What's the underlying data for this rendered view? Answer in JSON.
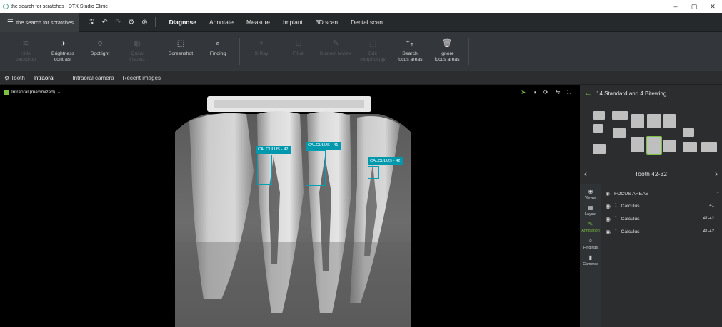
{
  "window": {
    "title": "the search for scratches - DTX Studio Clinic",
    "controls": [
      "–",
      "▢",
      "✕"
    ]
  },
  "menubar": {
    "app_menu_label": "the search for scratches",
    "tabs": [
      {
        "label": "Diagnose",
        "active": true
      },
      {
        "label": "Annotate",
        "active": false
      },
      {
        "label": "Measure",
        "active": false
      },
      {
        "label": "Implant",
        "active": false
      },
      {
        "label": "3D scan",
        "active": false
      },
      {
        "label": "Dental scan",
        "active": false
      }
    ]
  },
  "ribbon": {
    "tools": [
      {
        "label": "Hide\nbackdrop",
        "icon": "layers-icon",
        "disabled": true
      },
      {
        "label": "Brightness\ncontrast",
        "icon": "contrast-icon",
        "disabled": false
      },
      {
        "label": "Spotlight",
        "icon": "spotlight-icon",
        "disabled": false
      },
      {
        "label": "Quick\ninspect",
        "icon": "inspect-icon",
        "disabled": true
      },
      {
        "label": "Screenshot",
        "icon": "screenshot-icon",
        "disabled": false
      },
      {
        "label": "Finding",
        "icon": "finding-icon",
        "disabled": false
      },
      {
        "label": "X-Ray",
        "icon": "xray-icon",
        "disabled": true
      },
      {
        "label": "Fit all",
        "icon": "fit-icon",
        "disabled": true
      },
      {
        "label": "Custom review",
        "icon": "review-icon",
        "disabled": true
      },
      {
        "label": "Edit\nmorphology",
        "icon": "morphology-icon",
        "disabled": true
      },
      {
        "label": "Search\nfocus areas",
        "icon": "search-focus-icon",
        "disabled": false
      },
      {
        "label": "Ignore\nfocus areas",
        "icon": "ignore-focus-icon",
        "disabled": false
      }
    ]
  },
  "subtabs": {
    "items": [
      {
        "label": "Tooth",
        "active": false
      },
      {
        "label": "Intraoral",
        "active": true
      },
      {
        "label": "Intraoral camera",
        "active": false
      },
      {
        "label": "Recent images",
        "active": false
      }
    ],
    "more": "···"
  },
  "viewer": {
    "label": "Intraoral (maximized)",
    "annotations": [
      {
        "label": "CALCULUS - 42"
      },
      {
        "label": "CALCULUS - 41"
      },
      {
        "label": "CALCULUS - 42"
      }
    ]
  },
  "right_panel": {
    "header": "14 Standard and 4 Bitewing",
    "tooth_nav": "Tooth 42-32",
    "side_tools": [
      {
        "label": "Viewer",
        "icon": "eye-icon",
        "active": false
      },
      {
        "label": "Layout",
        "icon": "layout-icon",
        "active": false
      },
      {
        "label": "Annotation",
        "icon": "pencil-icon",
        "active": true
      },
      {
        "label": "Findings",
        "icon": "findings-icon",
        "active": false
      },
      {
        "label": "Cameras",
        "icon": "camera-icon",
        "active": false
      }
    ],
    "focus_areas": {
      "title": "FOCUS AREAS",
      "items": [
        {
          "name": "Calculus",
          "tooth": "41"
        },
        {
          "name": "Calculus",
          "tooth": "41-42"
        },
        {
          "name": "Calculus",
          "tooth": "41-42"
        }
      ]
    }
  },
  "colors": {
    "accent_green": "#7cc142",
    "annotation_teal": "#0098ad",
    "background_dark": "#2b2d2f"
  }
}
